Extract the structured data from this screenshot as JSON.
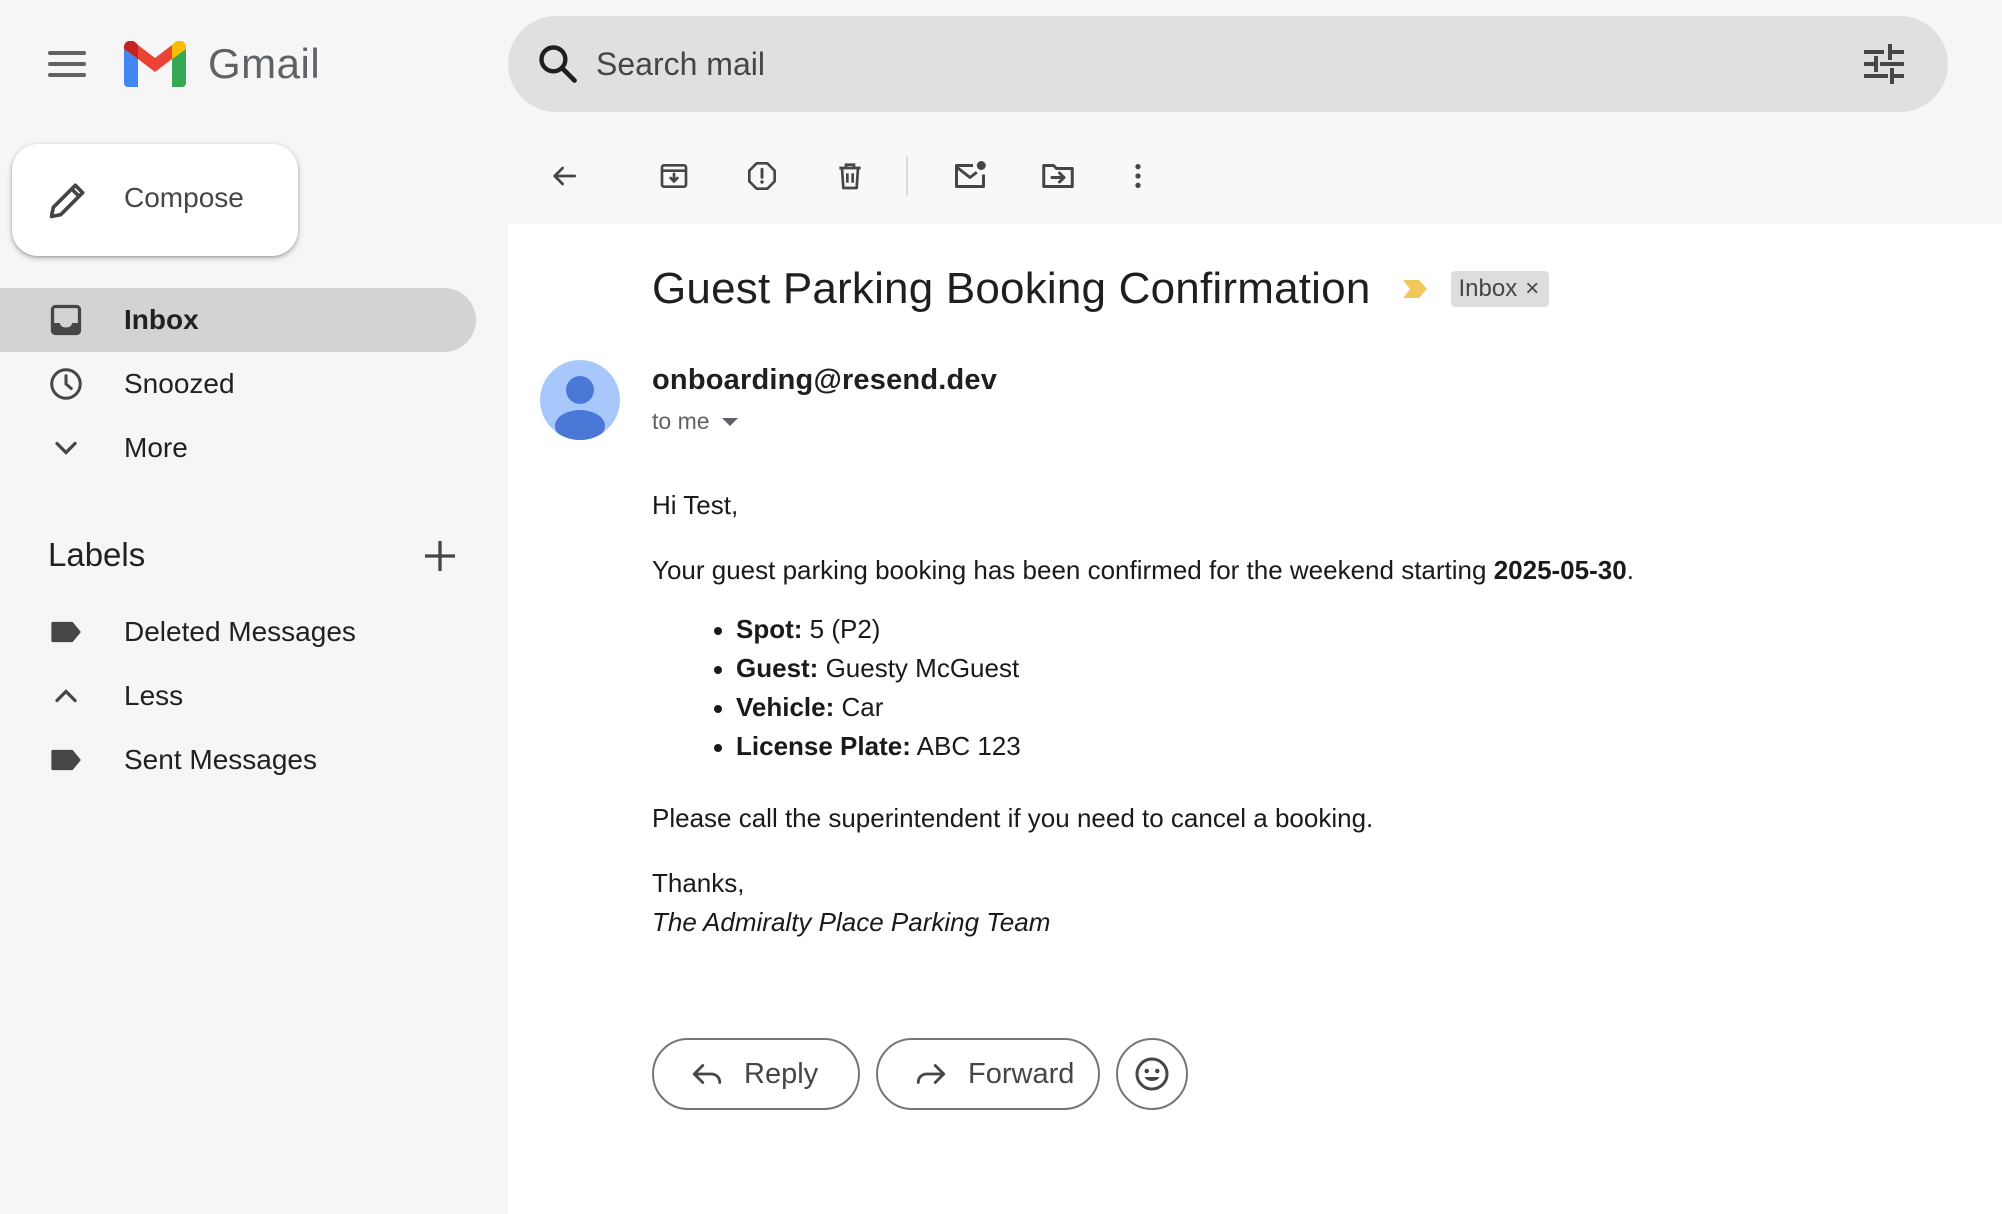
{
  "app": {
    "name": "Gmail"
  },
  "search": {
    "placeholder": "Search mail"
  },
  "sidebar": {
    "compose_label": "Compose",
    "nav": [
      {
        "label": "Inbox",
        "icon": "inbox-icon",
        "active": true
      },
      {
        "label": "Snoozed",
        "icon": "clock-icon",
        "active": false
      },
      {
        "label": "More",
        "icon": "chevron-down-icon",
        "active": false
      }
    ],
    "labels_heading": "Labels",
    "labels": [
      {
        "label": "Deleted Messages",
        "icon": "label-icon"
      },
      {
        "label": "Less",
        "icon": "chevron-up-icon"
      },
      {
        "label": "Sent Messages",
        "icon": "label-icon"
      }
    ]
  },
  "toolbar": {
    "icons": [
      "back-arrow-icon",
      "archive-icon",
      "report-spam-icon",
      "delete-icon",
      "mark-unread-icon",
      "move-to-icon",
      "more-vert-icon"
    ]
  },
  "email": {
    "subject": "Guest Parking Booking Confirmation",
    "chip_label": "Inbox",
    "chip_close": "×",
    "sender": "onboarding@resend.dev",
    "recipient": "to me",
    "greeting": "Hi Test,",
    "intro_text": "Your guest parking booking has been confirmed for the weekend starting ",
    "intro_date": "2025-05-30",
    "intro_end": ".",
    "details": [
      {
        "key": "Spot:",
        "value": " 5 (P2)"
      },
      {
        "key": "Guest:",
        "value": " Guesty McGuest"
      },
      {
        "key": "Vehicle:",
        "value": " Car"
      },
      {
        "key": "License Plate:",
        "value": " ABC 123"
      }
    ],
    "call_text": "Please call the superintendent if you need to cancel a booking.",
    "thanks": "Thanks,",
    "signature": "The Admiralty Place Parking Team"
  },
  "actions": {
    "reply_label": "Reply",
    "forward_label": "Forward"
  },
  "colors": {
    "background": "#f6f6f6",
    "active_nav": "#d3d3d3",
    "search_bg": "#e0e0e0",
    "avatar_bg": "#a8c7fa",
    "avatar_fg": "#4a78d6",
    "importance": "#f2c75c"
  }
}
